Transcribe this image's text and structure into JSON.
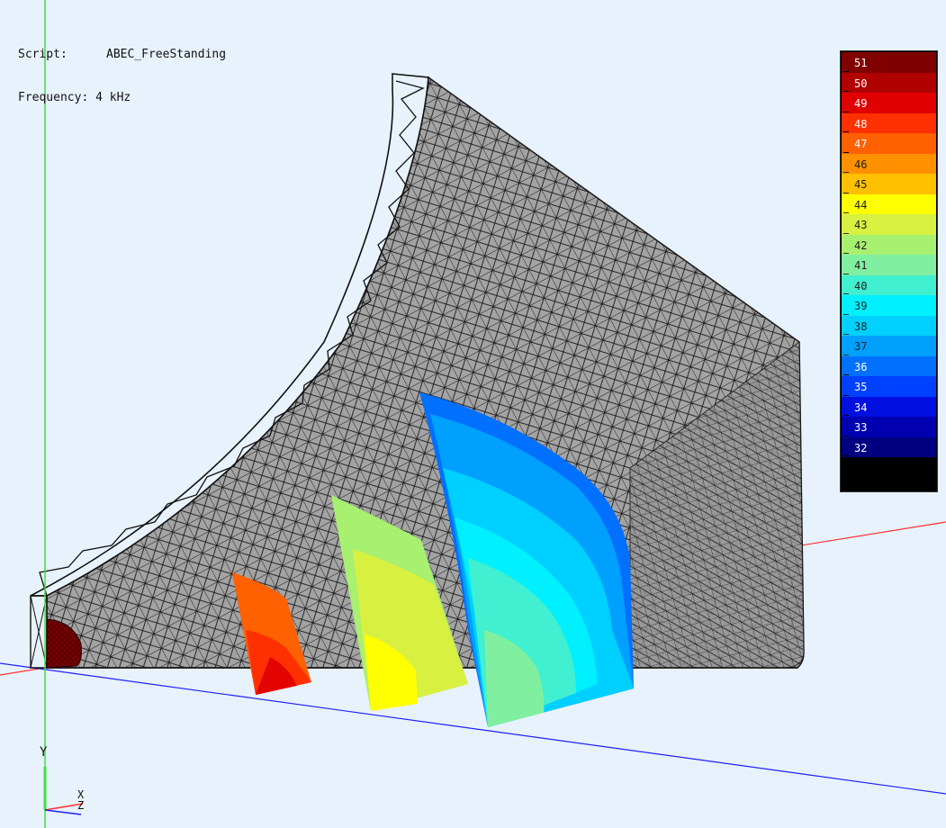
{
  "info": {
    "script_label": "Script:",
    "script_value": "ABEC_FreeStanding",
    "frequency_label": "Frequency:",
    "frequency_value": "4 kHz"
  },
  "legend": {
    "levels": [
      {
        "value": "51",
        "color": "#800000",
        "text": "#ffffff"
      },
      {
        "value": "50",
        "color": "#b00000",
        "text": "#ffffff"
      },
      {
        "value": "49",
        "color": "#e00000",
        "text": "#ffffff"
      },
      {
        "value": "48",
        "color": "#ff3000",
        "text": "#ffffff"
      },
      {
        "value": "47",
        "color": "#ff6000",
        "text": "#ffffff"
      },
      {
        "value": "46",
        "color": "#ff9000",
        "text": "#222222"
      },
      {
        "value": "45",
        "color": "#ffc000",
        "text": "#222222"
      },
      {
        "value": "44",
        "color": "#ffff00",
        "text": "#222222"
      },
      {
        "value": "43",
        "color": "#d8f040",
        "text": "#222222"
      },
      {
        "value": "42",
        "color": "#a8f070",
        "text": "#222222"
      },
      {
        "value": "41",
        "color": "#80f0a0",
        "text": "#222222"
      },
      {
        "value": "40",
        "color": "#40f0d0",
        "text": "#222222"
      },
      {
        "value": "39",
        "color": "#00f0ff",
        "text": "#222222"
      },
      {
        "value": "38",
        "color": "#00d0ff",
        "text": "#222222"
      },
      {
        "value": "37",
        "color": "#00a0ff",
        "text": "#222222"
      },
      {
        "value": "36",
        "color": "#0070ff",
        "text": "#ffffff"
      },
      {
        "value": "35",
        "color": "#0040ff",
        "text": "#ffffff"
      },
      {
        "value": "34",
        "color": "#0010e0",
        "text": "#ffffff"
      },
      {
        "value": "33",
        "color": "#0000b0",
        "text": "#ffffff"
      },
      {
        "value": "32",
        "color": "#000080",
        "text": "#ffffff"
      }
    ],
    "bottom_color": "#000000"
  },
  "axes": {
    "y_label": "Y",
    "x_label": "X",
    "z_label": "Z",
    "x_color": "#ff3030",
    "y_color": "#40e040",
    "z_color": "#2020ff"
  },
  "colors": {
    "background": "#e8f2fc",
    "mesh_fill": "#a0a0a0",
    "mesh_line": "#1a1a1a"
  }
}
